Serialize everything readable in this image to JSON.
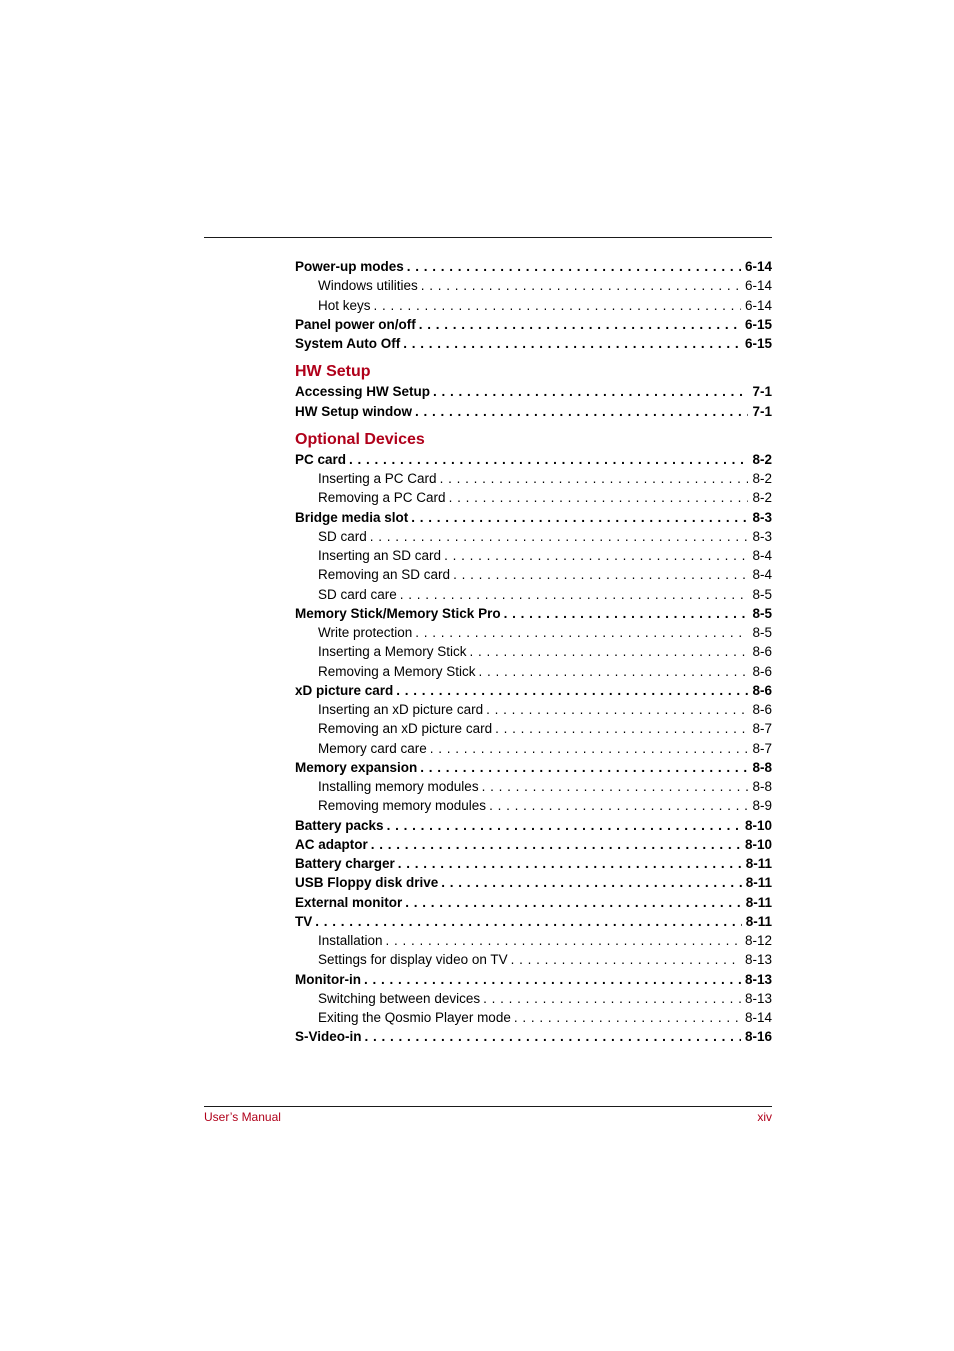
{
  "toc_groups": [
    {
      "heading": null,
      "entries": [
        {
          "label": "Power-up modes",
          "page": "6-14",
          "level": 1
        },
        {
          "label": "Windows utilities",
          "page": "6-14",
          "level": 2
        },
        {
          "label": "Hot keys",
          "page": "6-14",
          "level": 2
        },
        {
          "label": "Panel power on/off",
          "page": "6-15",
          "level": 1
        },
        {
          "label": "System Auto Off",
          "page": "6-15",
          "level": 1
        }
      ]
    },
    {
      "heading": "HW Setup",
      "entries": [
        {
          "label": "Accessing HW Setup",
          "page": "7-1",
          "level": 1
        },
        {
          "label": "HW Setup window",
          "page": "7-1",
          "level": 1
        }
      ]
    },
    {
      "heading": "Optional Devices",
      "entries": [
        {
          "label": "PC card",
          "page": "8-2",
          "level": 1
        },
        {
          "label": "Inserting a PC Card",
          "page": "8-2",
          "level": 2
        },
        {
          "label": "Removing a PC Card",
          "page": "8-2",
          "level": 2
        },
        {
          "label": "Bridge media slot",
          "page": "8-3",
          "level": 1
        },
        {
          "label": "SD card",
          "page": "8-3",
          "level": 2
        },
        {
          "label": "Inserting an SD card",
          "page": "8-4",
          "level": 2
        },
        {
          "label": "Removing an SD card",
          "page": "8-4",
          "level": 2
        },
        {
          "label": "SD card care",
          "page": "8-5",
          "level": 2
        },
        {
          "label": "Memory Stick/Memory Stick Pro",
          "page": "8-5",
          "level": 1
        },
        {
          "label": "Write protection",
          "page": "8-5",
          "level": 2
        },
        {
          "label": "Inserting a Memory Stick",
          "page": "8-6",
          "level": 2
        },
        {
          "label": "Removing a Memory Stick",
          "page": "8-6",
          "level": 2
        },
        {
          "label": "xD picture card",
          "page": "8-6",
          "level": 1
        },
        {
          "label": "Inserting an xD picture card",
          "page": "8-6",
          "level": 2
        },
        {
          "label": "Removing an xD picture card",
          "page": "8-7",
          "level": 2
        },
        {
          "label": "Memory card care",
          "page": "8-7",
          "level": 2
        },
        {
          "label": "Memory expansion",
          "page": "8-8",
          "level": 1
        },
        {
          "label": "Installing memory modules",
          "page": "8-8",
          "level": 2
        },
        {
          "label": "Removing memory modules",
          "page": "8-9",
          "level": 2
        },
        {
          "label": "Battery packs",
          "page": "8-10",
          "level": 1
        },
        {
          "label": "AC adaptor",
          "page": "8-10",
          "level": 1
        },
        {
          "label": "Battery charger",
          "page": "8-11",
          "level": 1
        },
        {
          "label": "USB Floppy disk drive",
          "page": "8-11",
          "level": 1
        },
        {
          "label": "External monitor",
          "page": "8-11",
          "level": 1
        },
        {
          "label": "TV",
          "page": "8-11",
          "level": 1
        },
        {
          "label": "Installation",
          "page": "8-12",
          "level": 2
        },
        {
          "label": "Settings for display video on TV",
          "page": "8-13",
          "level": 2
        },
        {
          "label": "Monitor-in",
          "page": "8-13",
          "level": 1
        },
        {
          "label": "Switching between devices",
          "page": "8-13",
          "level": 2
        },
        {
          "label": "Exiting the Qosmio Player mode",
          "page": "8-14",
          "level": 2
        },
        {
          "label": "S-Video-in",
          "page": "8-16",
          "level": 1
        }
      ]
    }
  ],
  "footer": {
    "left": "User’s Manual",
    "right": "xiv"
  },
  "colors": {
    "accent": "#b0001a"
  }
}
